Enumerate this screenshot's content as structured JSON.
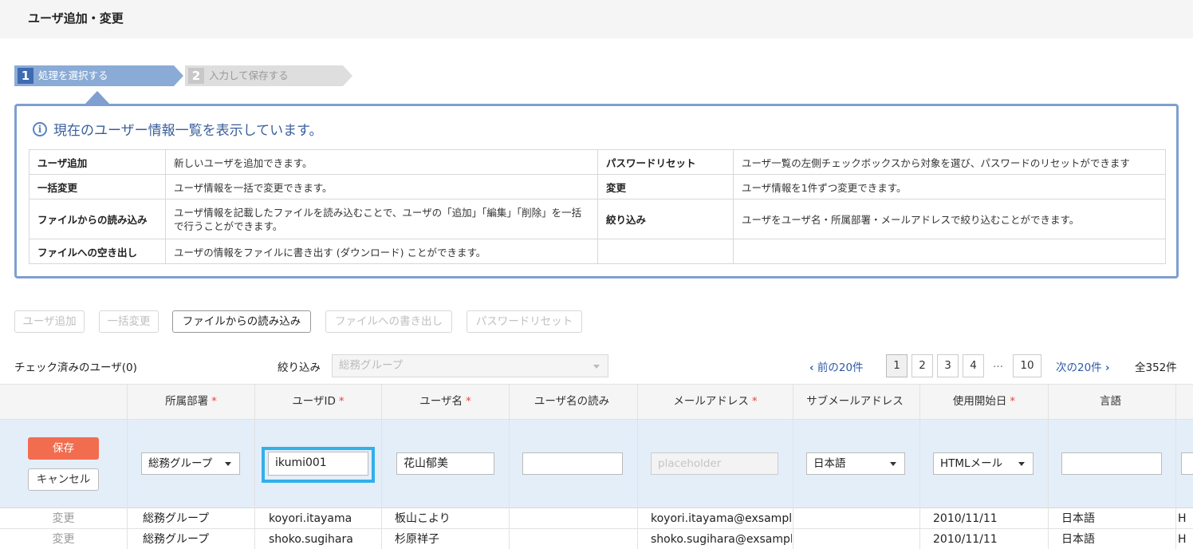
{
  "page": {
    "title": "ユーザ追加・変更"
  },
  "steps": [
    {
      "num": "1",
      "label": "処理を選択する"
    },
    {
      "num": "2",
      "label": "入力して保存する"
    }
  ],
  "info": {
    "heading": "現在のユーザー情報一覧を表示しています。",
    "rows": [
      {
        "k1": "ユーザ追加",
        "v1": "新しいユーザを追加できます。",
        "k2": "パスワードリセット",
        "v2": "ユーザ一覧の左側チェックボックスから対象を選び、パスワードのリセットができます"
      },
      {
        "k1": "一括変更",
        "v1": "ユーザ情報を一括で変更できます。",
        "k2": "変更",
        "v2": "ユーザ情報を1件ずつ変更できます。"
      },
      {
        "k1": "ファイルからの読み込み",
        "v1": "ユーザ情報を記載したファイルを読み込むことで、ユーザの「追加」「編集」「削除」を一括で行うことができます。",
        "k2": "絞り込み",
        "v2": "ユーザをユーザ名・所属部署・メールアドレスで絞り込むことができます。"
      },
      {
        "k1": "ファイルへの空き出し",
        "v1": "ユーザの情報をファイルに書き出す (ダウンロード) ことができます。",
        "k2": "",
        "v2": ""
      }
    ]
  },
  "actions": {
    "add_user": "ユーザ追加",
    "bulk_change": "一括変更",
    "import_file": "ファイルからの読み込み",
    "export_file": "ファイルへの書き出し",
    "password_reset": "パスワードリセット"
  },
  "toolbar": {
    "checked_users": "チェック済みのユーザ(0)",
    "filter_label": "絞り込み",
    "filter_value": "総務グループ"
  },
  "pagination": {
    "prev": "前の20件",
    "pages": [
      "1",
      "2",
      "3",
      "4"
    ],
    "dots": "…",
    "last": "10",
    "next": "次の20件",
    "total": "全352件"
  },
  "columns": [
    {
      "label": "所属部署",
      "required": "*"
    },
    {
      "label": "ユーザID",
      "required": "*"
    },
    {
      "label": "ユーザ名",
      "required": "*"
    },
    {
      "label": "ユーザ名の読み",
      "required": ""
    },
    {
      "label": "メールアドレス",
      "required": "*"
    },
    {
      "label": "サブメールアドレス",
      "required": ""
    },
    {
      "label": "使用開始日",
      "required": "*"
    },
    {
      "label": "言語",
      "required": ""
    }
  ],
  "edit_row": {
    "save": "保存",
    "cancel": "キャンセル",
    "department": "総務グループ",
    "user_id": "ikumi001",
    "user_name": "花山郁美",
    "reading": "",
    "email_placeholder": "placeholder",
    "language": "日本語",
    "mail_format": "HTMLメール",
    "language_text": ""
  },
  "rows": [
    {
      "action": "変更",
      "department": "総務グループ",
      "user_id": "koyori.itayama",
      "user_name": "板山こより",
      "email": "koyori.itayama@exsample.com",
      "start_date": "2010/11/11",
      "language": "日本語",
      "extra": "H"
    },
    {
      "action": "変更",
      "department": "総務グループ",
      "user_id": "shoko.sugihara",
      "user_name": "杉原祥子",
      "email": "shoko.sugihara@exsample.com",
      "start_date": "2010/11/11",
      "language": "日本語",
      "extra": "H"
    }
  ],
  "colors": {
    "accent": "#3e6bb1",
    "save": "#f26d50",
    "focus": "#31b0ea",
    "required": "#e8453c"
  },
  "icons": {
    "info": "info-icon",
    "caret": "chevron-down-icon",
    "prev": "chevron-left-icon",
    "next": "chevron-right-icon"
  }
}
